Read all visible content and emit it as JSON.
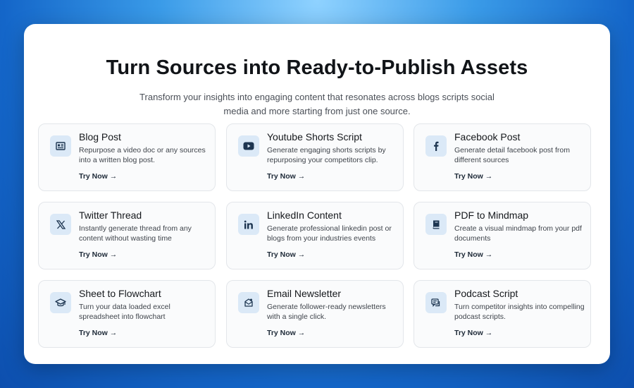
{
  "header": {
    "title": "Turn Sources into Ready-to-Publish Assets",
    "subtitle": "Transform your insights into engaging content that resonates across blogs scripts social media and more starting from just one source."
  },
  "cta_label": "Try Now →",
  "tiles": [
    {
      "icon": "blog-icon",
      "title": "Blog Post",
      "description": "Repurpose a video doc or any sources into a written blog post."
    },
    {
      "icon": "youtube-icon",
      "title": "Youtube Shorts Script",
      "description": "Generate engaging shorts scripts by repurposing your competitors clip."
    },
    {
      "icon": "facebook-icon",
      "title": "Facebook Post",
      "description": "Generate detail facebook post from different sources"
    },
    {
      "icon": "x-icon",
      "title": "Twitter Thread",
      "description": "Instantly generate thread from any content without wasting time"
    },
    {
      "icon": "linkedin-icon",
      "title": "LinkedIn Content",
      "description": "Generate professional linkedin post or blogs from your industries events"
    },
    {
      "icon": "book-icon",
      "title": "PDF to Mindmap",
      "description": "Create a visual mindmap from your pdf documents"
    },
    {
      "icon": "graduation-cap-icon",
      "title": "Sheet to Flowchart",
      "description": "Turn your data loaded excel spreadsheet into flowchart"
    },
    {
      "icon": "mail-icon",
      "title": "Email Newsletter",
      "description": "Generate follower-ready newsletters with a single click."
    },
    {
      "icon": "podcast-icon",
      "title": "Podcast Script",
      "description": "Turn competitor insights into compelling podcast scripts."
    }
  ]
}
